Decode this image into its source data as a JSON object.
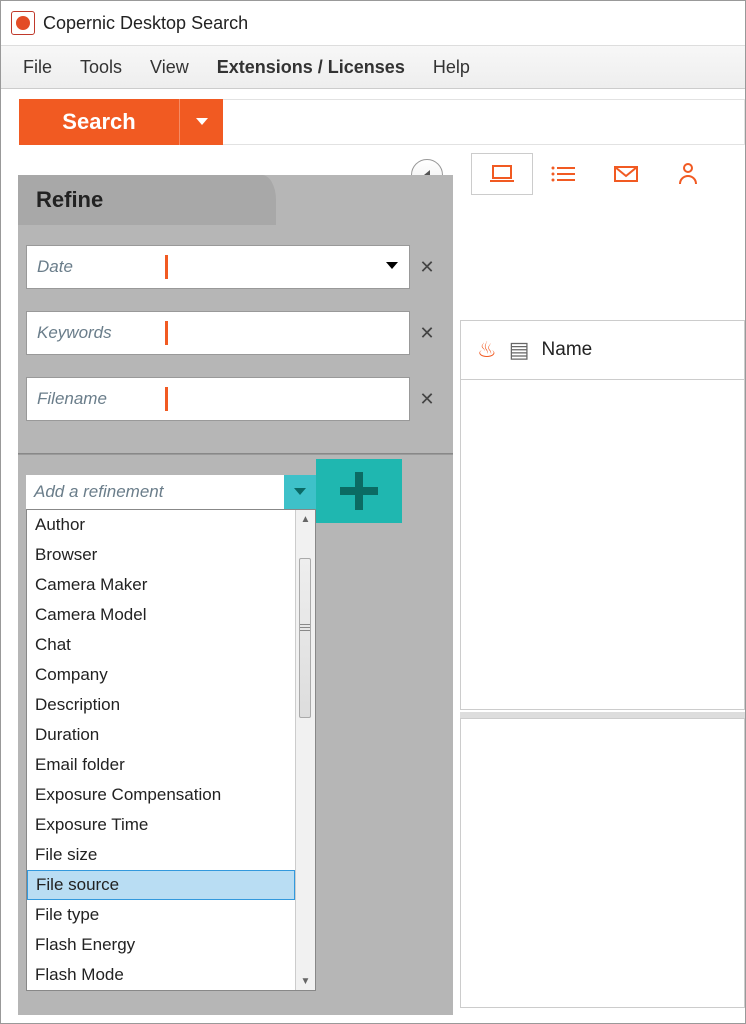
{
  "title": "Copernic Desktop Search",
  "menu": {
    "file": "File",
    "tools": "Tools",
    "view": "View",
    "extensions": "Extensions / Licenses",
    "help": "Help"
  },
  "search": {
    "button": "Search"
  },
  "refine": {
    "heading": "Refine",
    "rows": {
      "date": "Date",
      "keywords": "Keywords",
      "filename": "Filename"
    },
    "add": "Add a refinement",
    "items": [
      "Author",
      "Browser",
      "Camera Maker",
      "Camera Model",
      "Chat",
      "Company",
      "Description",
      "Duration",
      "Email folder",
      "Exposure Compensation",
      "Exposure Time",
      "File size",
      "File source",
      "File type",
      "Flash Energy",
      "Flash Mode"
    ],
    "selected": "File source"
  },
  "results": {
    "name_col": "Name"
  }
}
